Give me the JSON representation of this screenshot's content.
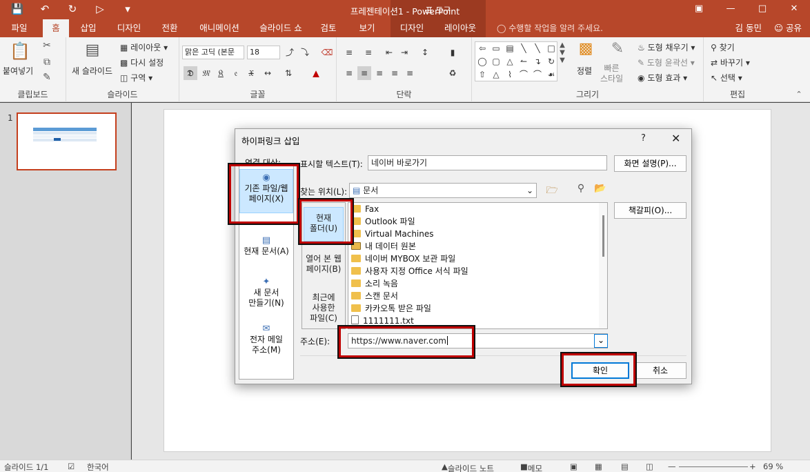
{
  "window": {
    "title": "프레젠테이션1 - PowerPoint",
    "context_tab_group": "표 도구",
    "quick_access": [
      "save-icon",
      "undo-icon",
      "redo-icon",
      "present-icon",
      "customize-icon"
    ]
  },
  "tabs": [
    {
      "label": "파일"
    },
    {
      "label": "홈"
    },
    {
      "label": "삽입"
    },
    {
      "label": "디자인"
    },
    {
      "label": "전환"
    },
    {
      "label": "애니메이션"
    },
    {
      "label": "슬라이드 쇼"
    },
    {
      "label": "검토"
    },
    {
      "label": "보기"
    },
    {
      "label": "디자인"
    },
    {
      "label": "레이아웃"
    }
  ],
  "tell_me": "수행할 작업을 알려 주세요.",
  "user_name": "김 동민",
  "share_label": "공유",
  "ribbon": {
    "clipboard": {
      "label": "클립보드",
      "paste": "붙여넣기"
    },
    "slides": {
      "label": "슬라이드",
      "new_slide": "새 슬라이드",
      "layout": "레이아웃",
      "reset": "다시 설정",
      "section": "구역"
    },
    "font": {
      "label": "글꼴",
      "font_name": "맑은 고딕 (본문",
      "font_size": "18"
    },
    "paragraph": {
      "label": "단락"
    },
    "drawing": {
      "label": "그리기",
      "arrange": "정렬",
      "quick_styles": "빠른\n스타일",
      "fill": "도형 채우기",
      "outline": "도형 윤곽선",
      "effects": "도형 효과"
    },
    "editing": {
      "label": "편집",
      "find": "찾기",
      "replace": "바꾸기",
      "select": "선택"
    }
  },
  "thumbnail": {
    "number": "1"
  },
  "status": {
    "slide": "슬라이드 1/1",
    "language": "한국어",
    "notes": "슬라이드 노트",
    "comments": "메모",
    "zoom": "69 %"
  },
  "dialog": {
    "title": "하이퍼링크 삽입",
    "help": "?",
    "link_to_label": "연결 대상:",
    "link_to_items": [
      "기존 파일/웹\n페이지(X)",
      "현재 문서(A)",
      "새 문서\n만들기(N)",
      "전자 메일\n주소(M)"
    ],
    "display_text_label": "표시할 텍스트(T):",
    "display_text_value": "네이버 바로가기",
    "screentip_button": "화면 설명(P)...",
    "look_in_label": "찾는 위치(L):",
    "look_in_value": "문서",
    "look_items": [
      "현재\n폴더(U)",
      "열어 본 웹\n페이지(B)",
      "최근에\n사용한\n파일(C)"
    ],
    "files": [
      "Fax",
      "Outlook 파일",
      "Virtual Machines",
      "내 데이터 원본",
      "네이버 MYBOX 보관 파일",
      "사용자 지정 Office 서식 파일",
      "소리 녹음",
      "스캔 문서",
      "카카오톡 받은 파일",
      "1111111.txt"
    ],
    "bookmark_button": "책갈피(O)...",
    "address_label": "주소(E):",
    "address_value": "https://www.naver.com",
    "ok_button": "확인",
    "cancel_button": "취소"
  }
}
